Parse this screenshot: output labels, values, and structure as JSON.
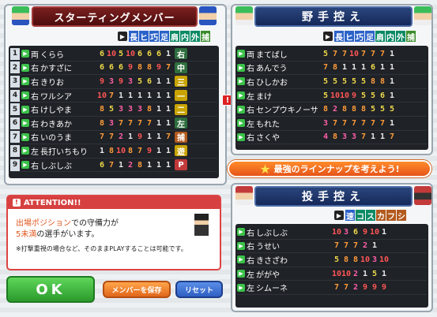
{
  "starting": {
    "title": "スターティングメンバー",
    "cols": [
      "長",
      "ヒ",
      "巧",
      "足",
      "肩",
      "内",
      "外",
      "捕"
    ],
    "rows": [
      {
        "n": "1",
        "hand": "両",
        "name": "くらら",
        "v": [
          "6",
          "10",
          "5",
          "10",
          "6",
          "6",
          "6",
          "1"
        ],
        "pos": "右",
        "posColor": "#2f6e3e"
      },
      {
        "n": "2",
        "hand": "右",
        "name": "かすざに",
        "v": [
          "6",
          "6",
          "6",
          "9",
          "8",
          "8",
          "9",
          "7"
        ],
        "pos": "中",
        "posColor": "#2f6e3e"
      },
      {
        "n": "3",
        "hand": "右",
        "name": "きりお",
        "v": [
          "9",
          "3",
          "9",
          "3",
          "5",
          "6",
          "1",
          "1"
        ],
        "pos": "三",
        "posColor": "#c9a400"
      },
      {
        "n": "4",
        "hand": "右",
        "name": "ワルシア",
        "v": [
          "10",
          "7",
          "1",
          "1",
          "1",
          "1",
          "1",
          "1"
        ],
        "pos": "一",
        "posColor": "#c9a400"
      },
      {
        "n": "5",
        "hand": "右",
        "name": "けしやま",
        "v": [
          "8",
          "5",
          "3",
          "3",
          "3",
          "8",
          "1",
          "1"
        ],
        "pos": "二",
        "posColor": "#c9a400"
      },
      {
        "n": "6",
        "hand": "右",
        "name": "わきあか",
        "v": [
          "8",
          "3",
          "7",
          "7",
          "7",
          "7",
          "1",
          "1"
        ],
        "pos": "左",
        "posColor": "#2f6e3e"
      },
      {
        "n": "7",
        "hand": "右",
        "name": "いのうま",
        "v": [
          "7",
          "7",
          "2",
          "1",
          "9",
          "1",
          "1",
          "7"
        ],
        "pos": "捕",
        "posColor": "#b35a1d"
      },
      {
        "n": "8",
        "hand": "左",
        "name": "長打いちもり",
        "v": [
          "1",
          "8",
          "10",
          "8",
          "7",
          "9",
          "1",
          "1"
        ],
        "pos": "遊",
        "posColor": "#c9a400"
      },
      {
        "n": "9",
        "hand": "右",
        "name": "しぶしぶ",
        "v": [
          "6",
          "7",
          "1",
          "2",
          "8",
          "1",
          "1",
          "1"
        ],
        "pos": "P",
        "posColor": "#c23a3a"
      }
    ]
  },
  "bench": {
    "title": "野手控え",
    "cols": [
      "長",
      "ヒ",
      "巧",
      "足",
      "肩",
      "内",
      "外",
      "捕"
    ],
    "rows": [
      {
        "hand": "両",
        "name": "まてばし",
        "v": [
          "5",
          "7",
          "7",
          "10",
          "7",
          "7",
          "7",
          "1"
        ]
      },
      {
        "hand": "右",
        "name": "あんでう",
        "v": [
          "7",
          "8",
          "1",
          "1",
          "1",
          "6",
          "1",
          "1"
        ]
      },
      {
        "hand": "右",
        "name": "ひしかお",
        "v": [
          "5",
          "5",
          "5",
          "5",
          "5",
          "8",
          "8",
          "1"
        ]
      },
      {
        "hand": "左",
        "name": "まけ",
        "v": [
          "5",
          "10",
          "10",
          "9",
          "5",
          "5",
          "6",
          "1"
        ]
      },
      {
        "hand": "右",
        "name": "センプウキノーサ",
        "v": [
          "8",
          "2",
          "8",
          "8",
          "8",
          "5",
          "5",
          "5"
        ]
      },
      {
        "hand": "左",
        "name": "もれた",
        "v": [
          "3",
          "7",
          "7",
          "7",
          "7",
          "7",
          "7",
          "1"
        ]
      },
      {
        "hand": "右",
        "name": "さくや",
        "v": [
          "4",
          "8",
          "3",
          "3",
          "7",
          "1",
          "1",
          "7"
        ]
      }
    ]
  },
  "pitchers": {
    "title": "投手控え",
    "cols": [
      "速",
      "コ",
      "ス",
      "カ",
      "フ",
      "シ"
    ],
    "rows": [
      {
        "hand": "右",
        "name": "しぶしぶ",
        "v": [
          "10",
          "3",
          "6",
          "9",
          "10",
          "1"
        ]
      },
      {
        "hand": "右",
        "name": "うせい",
        "v": [
          "7",
          "7",
          "7",
          "2",
          "1",
          " "
        ]
      },
      {
        "hand": "右",
        "name": "きさざわ",
        "v": [
          "5",
          "8",
          "8",
          "10",
          "3",
          "10"
        ]
      },
      {
        "hand": "左",
        "name": "ががや",
        "v": [
          "10",
          "10",
          "2",
          "1",
          "5",
          "1"
        ]
      },
      {
        "hand": "左",
        "name": "シムーネ",
        "v": [
          "7",
          "7",
          "2",
          "9",
          "9",
          "9"
        ]
      }
    ]
  },
  "banner": "最強のラインナップを考えよう!",
  "attention": {
    "header": "ATTENTION!!",
    "line1a": "出場ポジション",
    "line1b": "での守備力が",
    "line2a": "5未満",
    "line2b": "の選手がいます。",
    "note": "※打撃重視の場合など、そのままPLAYすることは可能です。"
  },
  "buttons": {
    "ok": "OK",
    "save": "メンバーを保存",
    "reset": "リセット"
  },
  "colors": {
    "accent": "#2a467c",
    "warn": "#d64040",
    "ok": "#3ab04a"
  }
}
